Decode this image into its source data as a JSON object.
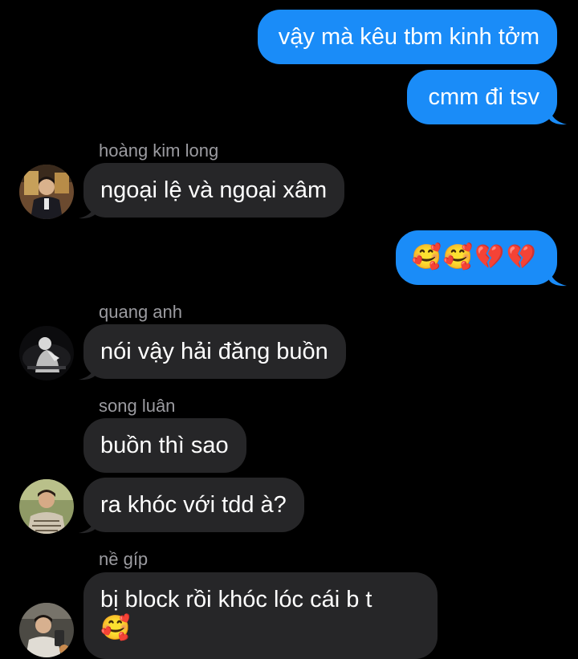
{
  "messages": [
    {
      "id": "m1",
      "direction": "outgoing",
      "text": "vậy mà kêu tbm kinh tởm"
    },
    {
      "id": "m2",
      "direction": "outgoing",
      "text": "cmm đi tsv"
    },
    {
      "id": "m3",
      "direction": "incoming",
      "sender": "hoàng kim long",
      "text": "ngoại lệ và ngoại xâm"
    },
    {
      "id": "m4",
      "direction": "outgoing",
      "emojis": [
        "🥰",
        "🥰",
        "💔",
        "💔"
      ]
    },
    {
      "id": "m5",
      "direction": "incoming",
      "sender": "quang anh",
      "text": "nói vậy hải đăng buồn"
    },
    {
      "id": "m6",
      "direction": "incoming",
      "sender": "song luân",
      "text": "buồn thì sao"
    },
    {
      "id": "m7",
      "direction": "incoming",
      "text": "ra khóc với tdd à?"
    },
    {
      "id": "m8",
      "direction": "incoming",
      "sender": "nề gíp",
      "text": "bị block rồi khóc lóc cái b t",
      "emoji": "🥰"
    }
  ],
  "avatars": {
    "hoang_kim_long": "avatar-hoang-kim-long",
    "quang_anh": "avatar-quang-anh",
    "song_luan": "avatar-song-luan",
    "ne_gip": "avatar-ne-gip"
  },
  "colors": {
    "background": "#000000",
    "outgoing_bubble": "#1a8cf8",
    "incoming_bubble": "#262628",
    "sender_name": "#9b9ba0",
    "text": "#ffffff"
  }
}
